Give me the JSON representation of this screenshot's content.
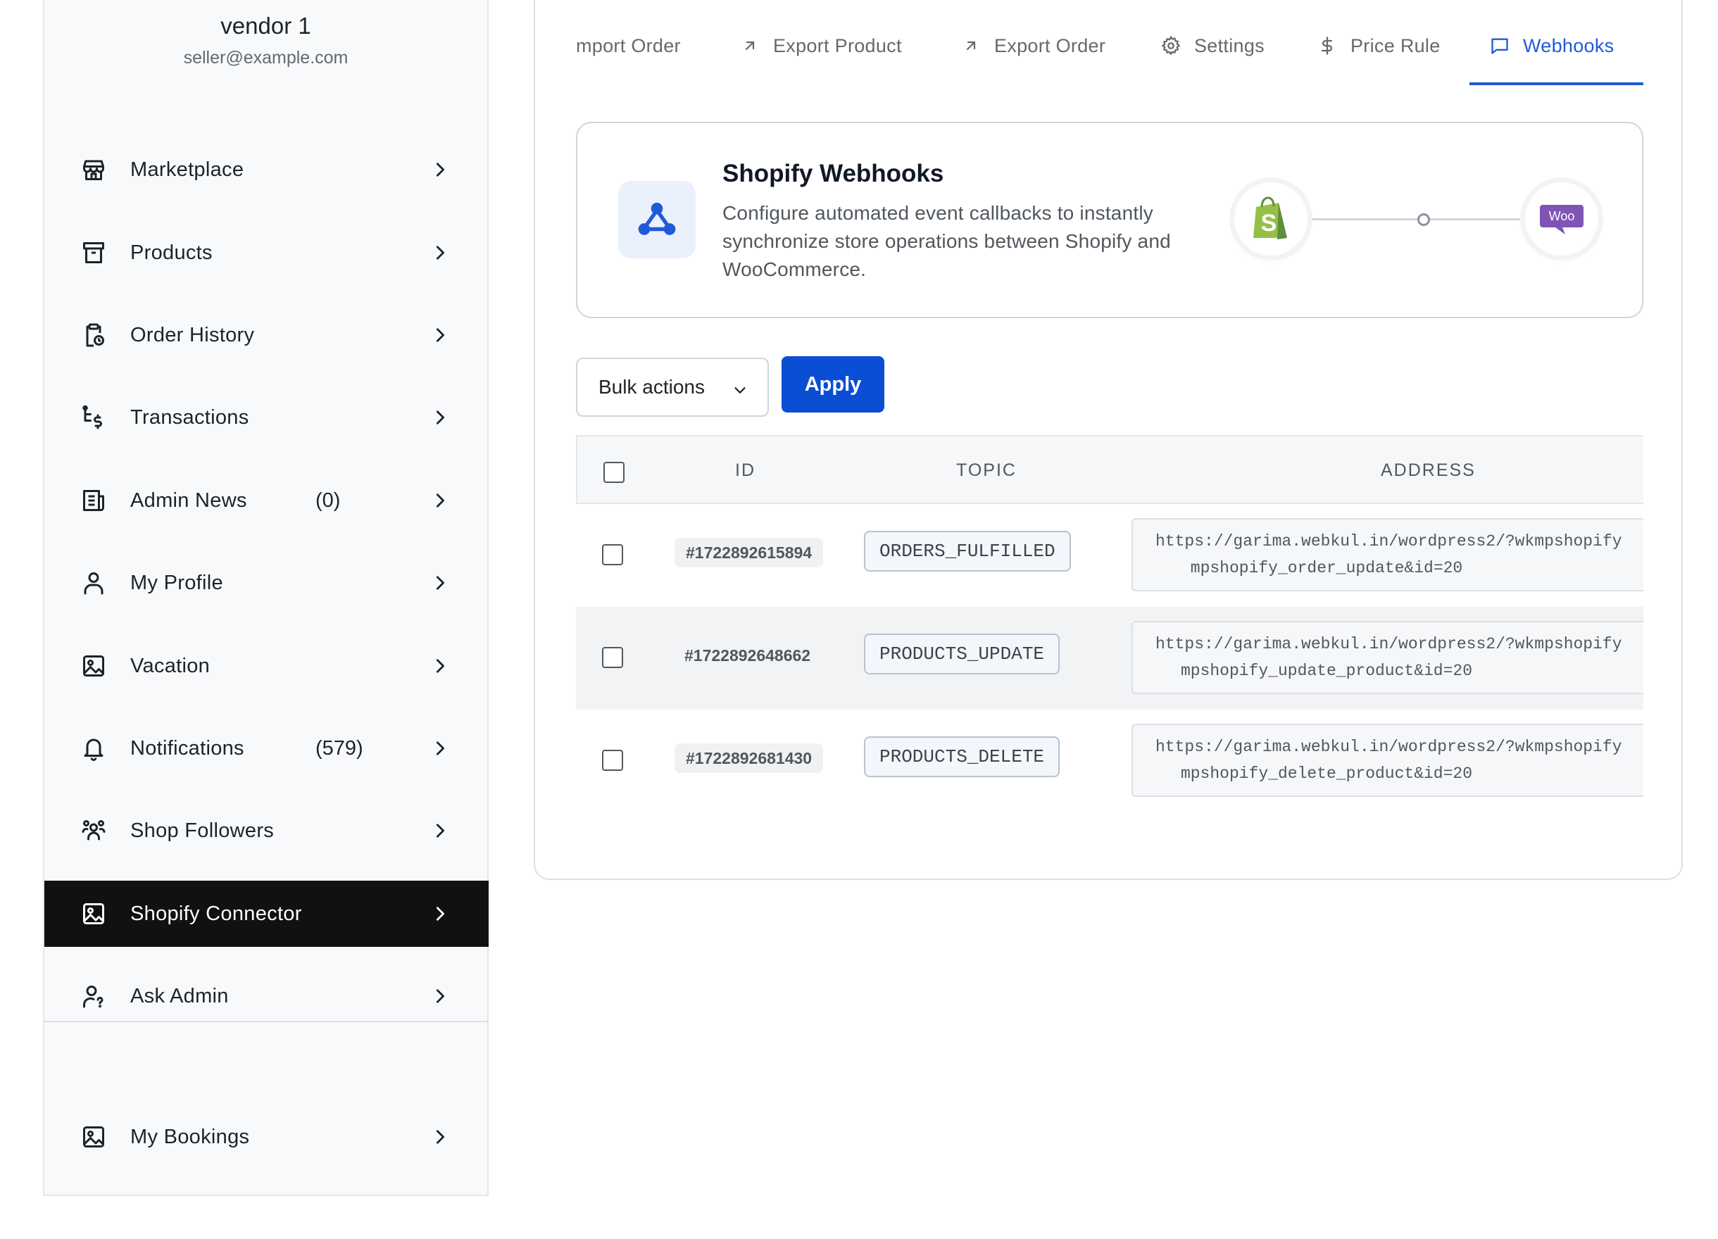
{
  "vendor": {
    "name": "vendor 1",
    "email": "seller@example.com"
  },
  "sidebar": {
    "items": [
      {
        "label": "Marketplace",
        "count": "",
        "icon": "store-icon"
      },
      {
        "label": "Products",
        "count": "",
        "icon": "archive-icon"
      },
      {
        "label": "Order History",
        "count": "",
        "icon": "clipboard-clock-icon"
      },
      {
        "label": "Transactions",
        "count": "",
        "icon": "transactions-icon"
      },
      {
        "label": "Admin News",
        "count": "(0)",
        "icon": "news-icon"
      },
      {
        "label": "My Profile",
        "count": "",
        "icon": "user-icon"
      },
      {
        "label": "Vacation",
        "count": "",
        "icon": "image-icon"
      },
      {
        "label": "Notifications",
        "count": "(579)",
        "icon": "bell-icon"
      },
      {
        "label": "Shop Followers",
        "count": "",
        "icon": "users-icon"
      },
      {
        "label": "Shopify Connector",
        "count": "",
        "icon": "image-icon",
        "active": true
      },
      {
        "label": "Ask Admin",
        "count": "",
        "icon": "user-question-icon"
      },
      {
        "label": "My Bookings",
        "count": "",
        "icon": "image-icon"
      }
    ]
  },
  "tabs": [
    {
      "label": "mport Order",
      "icon": ""
    },
    {
      "label": "Export Product",
      "icon": "arrow-up-right-icon"
    },
    {
      "label": "Export Order",
      "icon": "arrow-up-right-icon"
    },
    {
      "label": "Settings",
      "icon": "gear-icon"
    },
    {
      "label": "Price Rule",
      "icon": "dollar-icon"
    },
    {
      "label": "Webhooks",
      "icon": "message-square-icon",
      "active": true
    }
  ],
  "card": {
    "title": "Shopify Webhooks",
    "description": "Configure automated event callbacks to instantly synchronize store operations between Shopify and WooCommerce.",
    "woo_label": "Woo"
  },
  "toolbar": {
    "bulk_actions": "Bulk actions",
    "apply": "Apply"
  },
  "table": {
    "headers": {
      "id": "ID",
      "topic": "TOPIC",
      "address": "ADDRESS"
    },
    "rows": [
      {
        "id": "#1722892615894",
        "topic": "ORDERS_FULFILLED",
        "address_line1": "https://garima.webkul.in/wordpress2/?wkmpshopify",
        "address_line2": "mpshopify_order_update&id=20"
      },
      {
        "id": "#1722892648662",
        "topic": "PRODUCTS_UPDATE",
        "address_line1": "https://garima.webkul.in/wordpress2/?wkmpshopify",
        "address_line2": "mpshopify_update_product&id=20"
      },
      {
        "id": "#1722892681430",
        "topic": "PRODUCTS_DELETE",
        "address_line1": "https://garima.webkul.in/wordpress2/?wkmpshopify",
        "address_line2": "mpshopify_delete_product&id=20"
      }
    ]
  },
  "colors": {
    "accent": "#0a4ed4",
    "tab_active": "#1f5ad8",
    "sidebar_active_bg": "#111111",
    "woo_purple": "#7f54b3",
    "shopify_green": "#95bf47"
  }
}
